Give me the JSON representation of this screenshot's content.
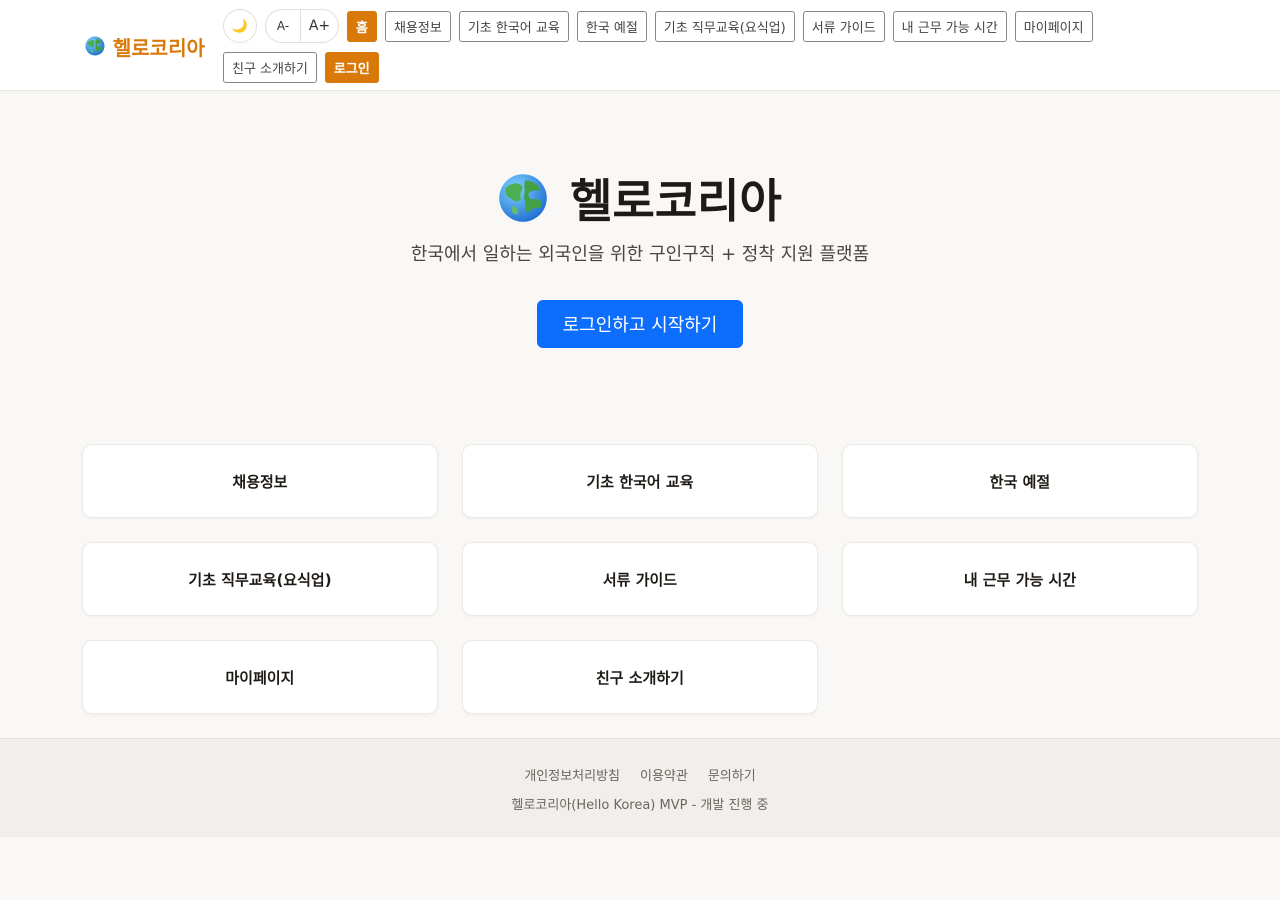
{
  "brand": {
    "name": "헬로코리아",
    "icon": "globe-icon"
  },
  "header": {
    "theme_toggle": "🌙",
    "font_decrease": "A-",
    "font_increase": "A+",
    "nav": [
      {
        "label": "홈",
        "active": true
      },
      {
        "label": "채용정보"
      },
      {
        "label": "기초 한국어 교육"
      },
      {
        "label": "한국 예절"
      },
      {
        "label": "기초 직무교육(요식업)"
      },
      {
        "label": "서류 가이드"
      },
      {
        "label": "내 근무 가능 시간"
      },
      {
        "label": "마이페이지"
      },
      {
        "label": "친구 소개하기"
      },
      {
        "label": "로그인",
        "active": true
      }
    ]
  },
  "hero": {
    "title": "헬로코리아",
    "subtitle": "한국에서 일하는 외국인을 위한 구인구직 + 정착 지원 플랫폼",
    "cta": "로그인하고 시작하기"
  },
  "cards": [
    {
      "label": "채용정보"
    },
    {
      "label": "기초 한국어 교육"
    },
    {
      "label": "한국 예절"
    },
    {
      "label": "기초 직무교육(요식업)"
    },
    {
      "label": "서류 가이드"
    },
    {
      "label": "내 근무 가능 시간"
    },
    {
      "label": "마이페이지"
    },
    {
      "label": "친구 소개하기"
    }
  ],
  "footer": {
    "links": [
      "개인정보처리방침",
      "이용약관",
      "문의하기"
    ],
    "copy": "헬로코리아(Hello Korea) MVP - 개발 진행 중"
  },
  "colors": {
    "accent": "#d9790a",
    "primary": "#0d6efd",
    "background": "#f9f8f6"
  }
}
